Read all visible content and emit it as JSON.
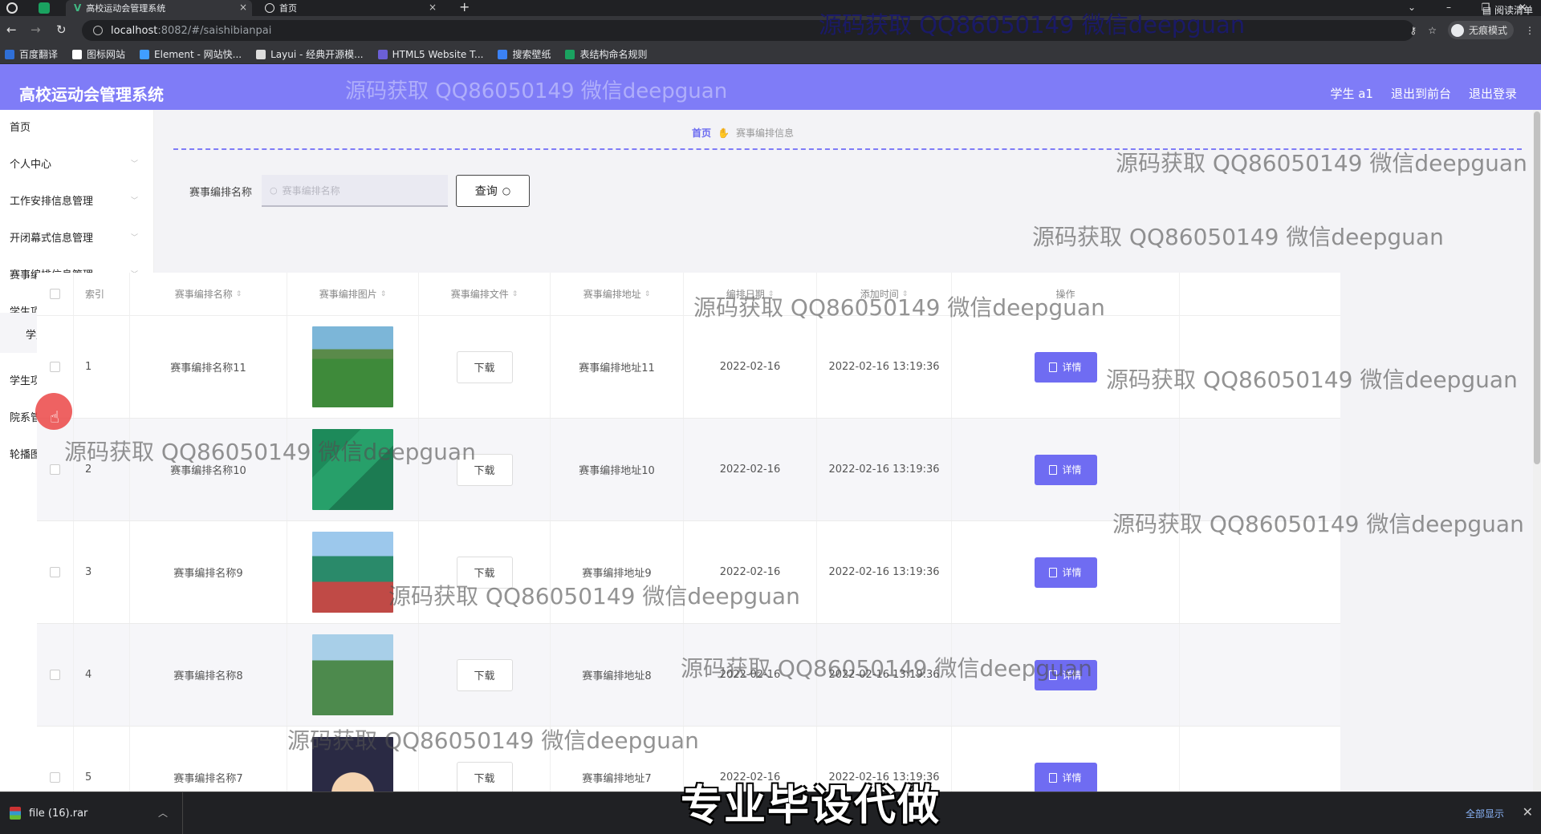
{
  "browser": {
    "tabs": [
      {
        "title": "高校运动会管理系统",
        "close": "×"
      },
      {
        "title": "首页",
        "close": "×"
      }
    ],
    "new_tab": "+",
    "window_controls": [
      "⌄",
      "–",
      "❐",
      "✕"
    ],
    "url_host": "localhost",
    "url_path": ":8082/#/saishibianpai",
    "incognito_label": "无痕模式",
    "bookmarks": [
      {
        "label": "百度翻译",
        "icon": "baidu-translate-icon",
        "color": "#2f6fd6"
      },
      {
        "label": "图标网站",
        "icon": "flag-icon",
        "color": "#ffffff"
      },
      {
        "label": "Element - 网站快...",
        "icon": "element-icon",
        "color": "#409eff"
      },
      {
        "label": "Layui - 经典开源模...",
        "icon": "layui-icon",
        "color": "#dddddd"
      },
      {
        "label": "HTML5 Website T...",
        "icon": "html5-icon",
        "color": "#6b5fd6"
      },
      {
        "label": "搜索壁纸",
        "icon": "wallpaper-icon",
        "color": "#3b82f6"
      },
      {
        "label": "表结构命名规则",
        "icon": "sheet-icon",
        "color": "#1aa260"
      }
    ],
    "reading_list": "阅读清单"
  },
  "app": {
    "title": "高校运动会管理系统",
    "user": "学生 a1",
    "to_front": "退出到前台",
    "logout": "退出登录",
    "accent": "#7f7cf7"
  },
  "sidebar": {
    "items": [
      {
        "label": "首页",
        "has_chevron": false
      },
      {
        "label": "个人中心",
        "has_chevron": true
      },
      {
        "label": "工作安排信息管理",
        "has_chevron": true
      },
      {
        "label": "开闭幕式信息管理",
        "has_chevron": true
      },
      {
        "label": "赛事编排信息管理",
        "has_chevron": true
      },
      {
        "label": "学生项目管理",
        "has_chevron": true,
        "expanded": true
      },
      {
        "label": "学生项目报名管理",
        "has_chevron": true
      },
      {
        "label": "院系管理",
        "has_chevron": true
      },
      {
        "label": "轮播图信息",
        "has_chevron": true
      }
    ],
    "submenu_item": "学生项目管理"
  },
  "breadcrumb": {
    "home": "首页",
    "current": "赛事编排信息"
  },
  "search": {
    "label": "赛事编排名称",
    "placeholder": "赛事编排名称",
    "button": "查询"
  },
  "table": {
    "columns": [
      "索引",
      "赛事编排名称",
      "赛事编排图片",
      "赛事编排文件",
      "赛事编排地址",
      "编排日期",
      "添加时间",
      "操作"
    ],
    "rows": [
      {
        "index": "1",
        "name": "赛事编排名称11",
        "file_btn": "下载",
        "address": "赛事编排地址11",
        "date": "2022-02-16",
        "added": "2022-02-16 13:19:36",
        "action": "详情",
        "thumb": "soccer-field"
      },
      {
        "index": "2",
        "name": "赛事编排名称10",
        "file_btn": "下载",
        "address": "赛事编排地址10",
        "date": "2022-02-16",
        "added": "2022-02-16 13:19:36",
        "action": "详情",
        "thumb": "badminton-court"
      },
      {
        "index": "3",
        "name": "赛事编排名称9",
        "file_btn": "下载",
        "address": "赛事编排地址9",
        "date": "2022-02-16",
        "added": "2022-02-16 13:19:36",
        "action": "详情",
        "thumb": "tennis-court"
      },
      {
        "index": "4",
        "name": "赛事编排名称8",
        "file_btn": "下载",
        "address": "赛事编排地址8",
        "date": "2022-02-16",
        "added": "2022-02-16 13:19:36",
        "action": "详情",
        "thumb": "fenced-field"
      },
      {
        "index": "5",
        "name": "赛事编排名称7",
        "file_btn": "下载",
        "address": "赛事编排地址7",
        "date": "2022-02-16",
        "added": "2022-02-16 13:19:36",
        "action": "详情",
        "thumb": "cartoon-face"
      }
    ]
  },
  "download_bar": {
    "file": "file (16).rar",
    "show_all": "全部显示",
    "close": "✕"
  },
  "overlays": {
    "watermark": "源码获取 QQ86050149 微信deepguan",
    "caption": "专业毕设代做"
  }
}
